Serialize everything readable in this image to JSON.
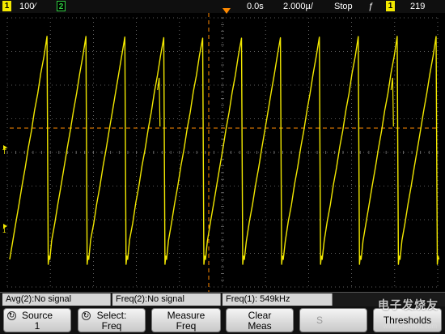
{
  "topbar": {
    "ch1_num": "1",
    "ch1_scale": "100∕",
    "ch2_num": "2",
    "trig_time": "0.0s",
    "timebase": "2.000µ/",
    "run_state": "Stop",
    "trigger_slope": "ƒ",
    "trig_ch_num": "1",
    "trig_level": "219"
  },
  "measurements": [
    {
      "text": "Avg(2):No signal"
    },
    {
      "text": "Freq(2):No signal"
    },
    {
      "text": "Freq(1): 549kHz"
    }
  ],
  "softkeys": {
    "source": {
      "line1": "Source",
      "line2": "1"
    },
    "select": {
      "line1": "Select:",
      "line2": "Freq"
    },
    "measure": {
      "line1": "Measure",
      "line2": "Freq"
    },
    "clear": {
      "line1": "Clear",
      "line2": "Meas"
    },
    "settings": {
      "line1": "S"
    },
    "thresholds": {
      "line1": "Thresholds"
    }
  },
  "markers": {
    "trigger_level": "T",
    "ch1_ground": "1"
  },
  "watermark": {
    "brand": "电子发烧友",
    "url": "www.elecfans.com"
  },
  "colors": {
    "trace": "#f2e800",
    "grid": "#7a7a7a",
    "trigger": "#ff8a00",
    "ch2": "#2ecc40"
  },
  "signal": {
    "channel": "1",
    "waveform": "sawtooth",
    "frequency": "549kHz",
    "cycles_visible": 11
  }
}
